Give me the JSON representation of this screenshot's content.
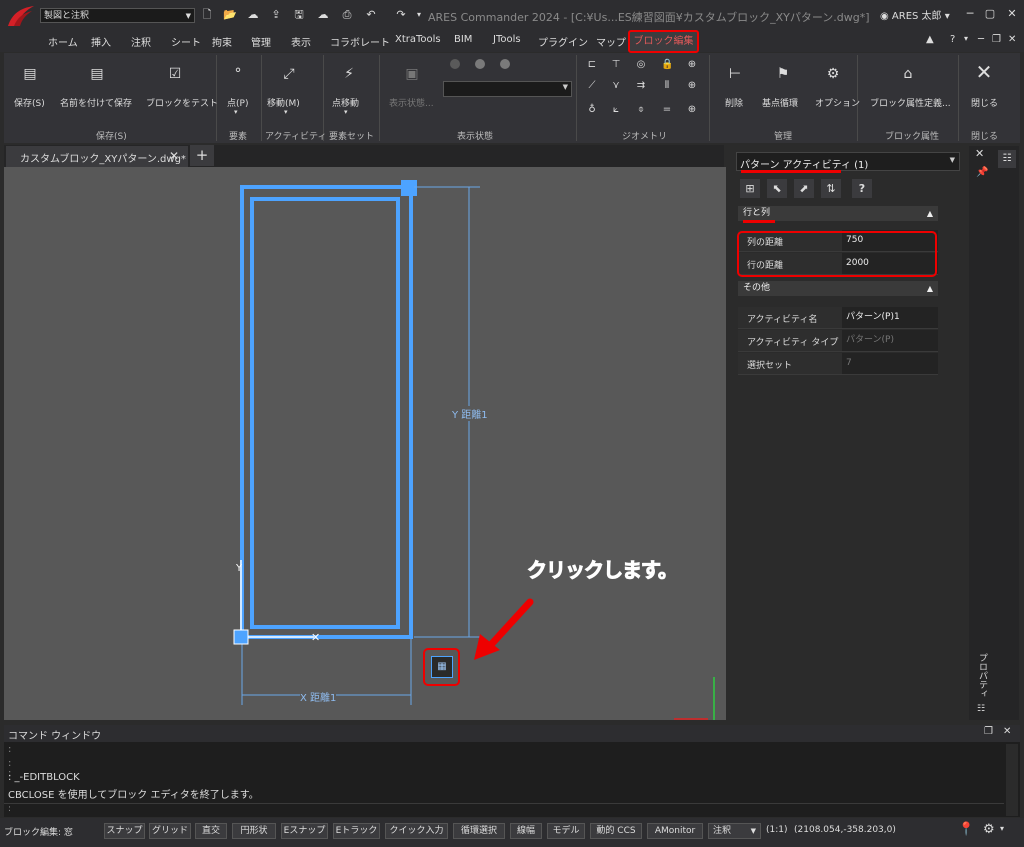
{
  "titlebar": {
    "workspace": "製図と注釈",
    "app_title": "ARES Commander 2024 - [C:¥Us...ES練習図面¥カスタムブロック_XYパターン.dwg*]",
    "user": "ARES 太郎"
  },
  "menu": {
    "tabs": [
      "ホーム",
      "挿入",
      "注釈",
      "シート",
      "拘束",
      "管理",
      "表示",
      "コラボレート",
      "XtraTools",
      "BIM",
      "JTools",
      "プラグイン",
      "マップ"
    ],
    "active_tab": "ブロック編集",
    "right": [
      "▲",
      "?"
    ]
  },
  "ribbon": {
    "save_group": {
      "label": "保存(S)",
      "buttons": [
        "保存(S)",
        "名前を付けて保存",
        "ブロックをテスト"
      ]
    },
    "elements_group": {
      "label": "要素",
      "button": "点(P)"
    },
    "activity_group": {
      "label": "アクティビティ",
      "button": "移動(M)"
    },
    "elemset_group": {
      "label": "要素セット",
      "button": "点移動"
    },
    "display_group": {
      "label": "表示状態",
      "button": "表示状態..."
    },
    "geometry_group": {
      "label": "ジオメトリ"
    },
    "manage_group": {
      "label": "管理",
      "buttons": [
        "削除",
        "基点循環",
        "オプション"
      ]
    },
    "attr_group": {
      "label": "ブロック属性",
      "button": "ブロック属性定義..."
    },
    "close_group": {
      "label": "閉じる",
      "button": "閉じる"
    }
  },
  "document": {
    "tab_label": "カスタムブロック_XYパターン.dwg*",
    "dim_x": "X  距離1",
    "dim_y": "Y  距離1",
    "annotation": "クリックします。"
  },
  "properties": {
    "selector": "パターン アクティビティ (1)",
    "section1": "行と列",
    "rows1": [
      {
        "key": "列の距離",
        "value": "750"
      },
      {
        "key": "行の距離",
        "value": "2000"
      }
    ],
    "section2": "その他",
    "rows2": [
      {
        "key": "アクティビティ名",
        "value": "パターン(P)1"
      },
      {
        "key": "アクティビティ タイプ",
        "value": "パターン(P)"
      },
      {
        "key": "選択セット",
        "value": "7"
      }
    ],
    "side_label": "プロパティ"
  },
  "command": {
    "title": "コマンド ウィンドウ",
    "lines": [
      ":",
      ":",
      ":",
      ": _-EDITBLOCK",
      "CBCLOSE を使用してブロック エディタを終了します。"
    ],
    "prompt": ":"
  },
  "status": {
    "mode": "ブロック編集: 窓",
    "buttons": [
      "スナップ",
      "グリッド",
      "直交",
      "円形状",
      "Eスナップ",
      "Eトラック",
      "クイック入力",
      "循環選択",
      "線幅",
      "モデル",
      "動的 CCS",
      "AMonitor"
    ],
    "annotation": "注釈",
    "scale": "(1:1)",
    "coords": "(2108.054,-358.203,0)"
  },
  "colors": {
    "accent_red": "#e00000",
    "blue": "#4da3ff"
  }
}
